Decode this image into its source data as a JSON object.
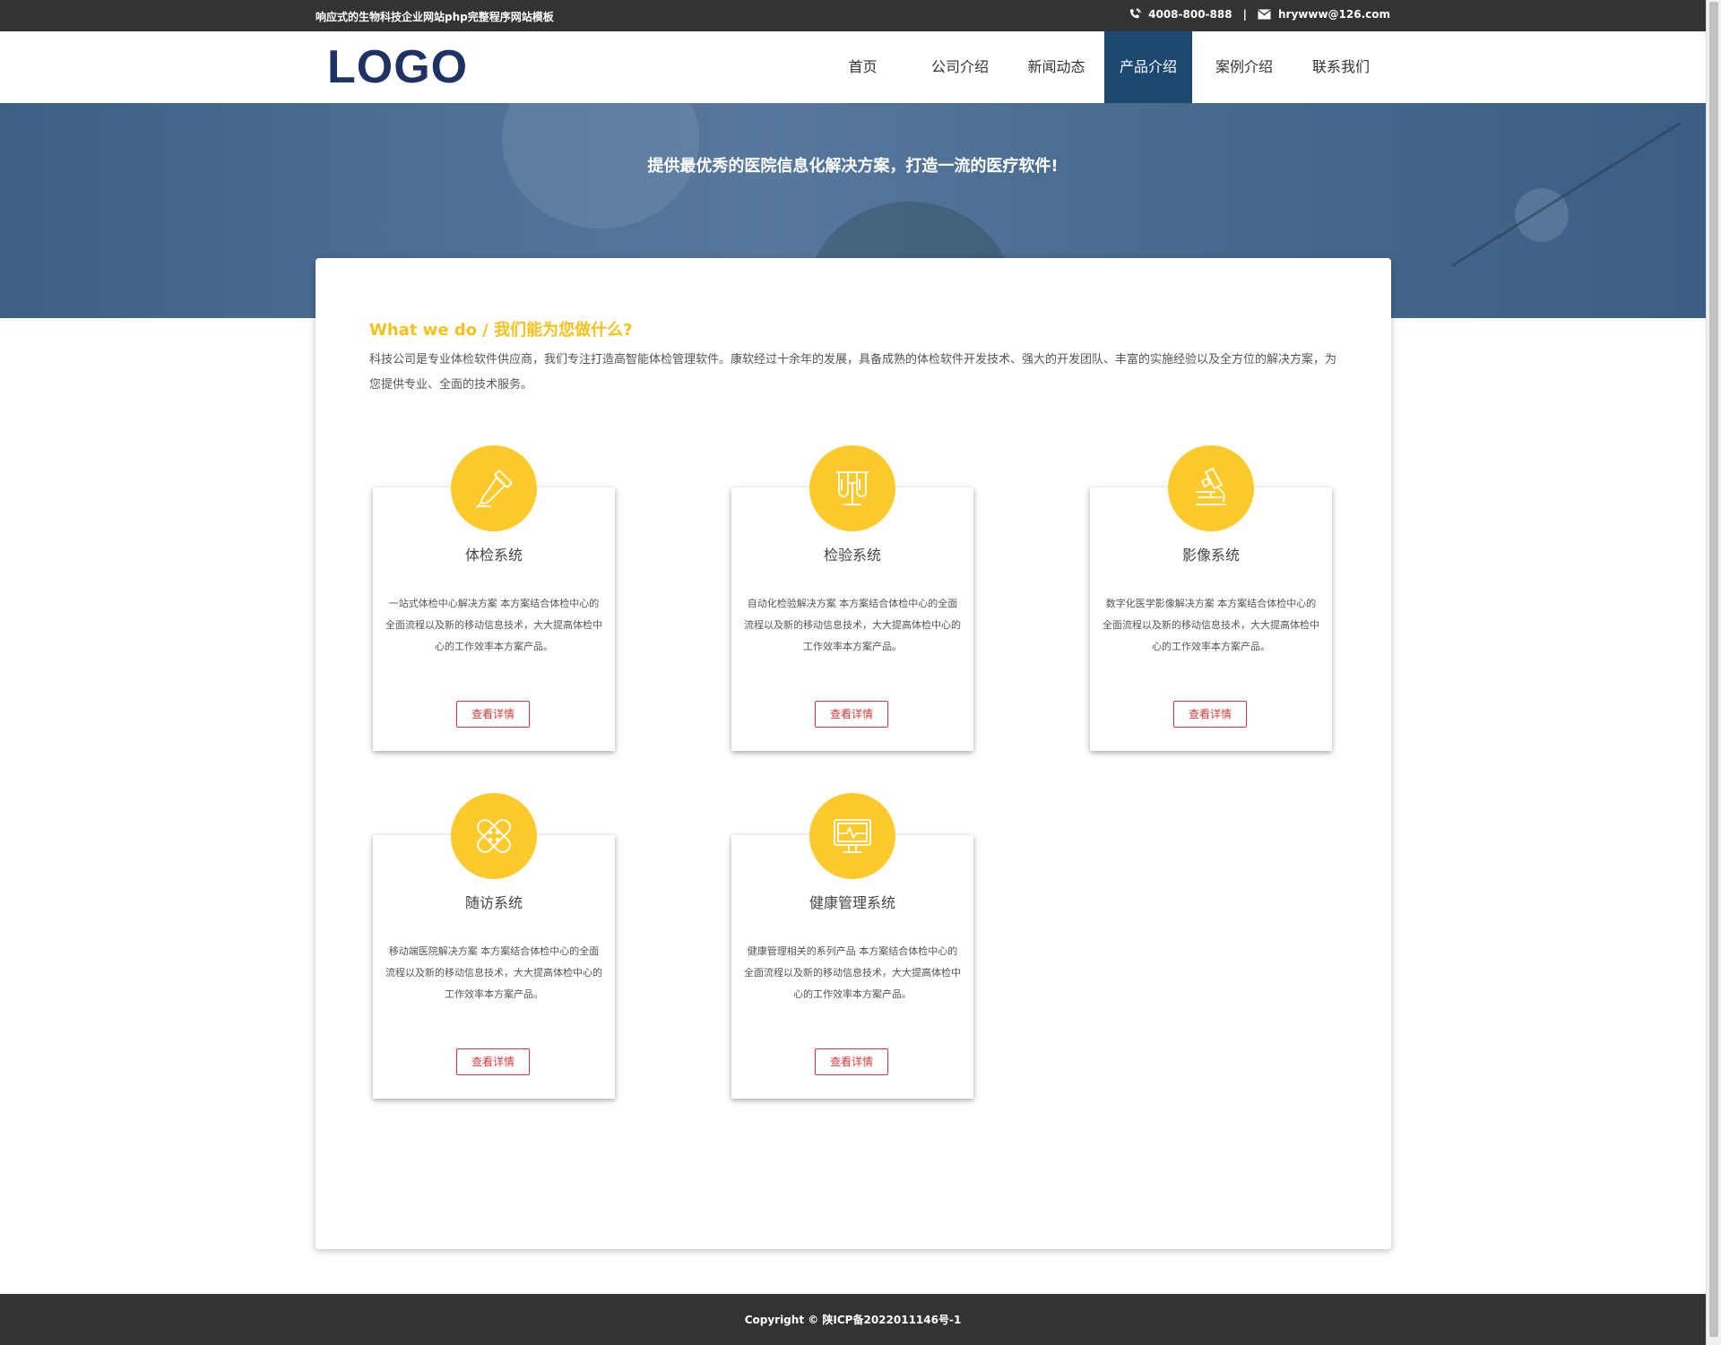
{
  "topbar": {
    "site_name": "响应式的生物科技企业网站php完整程序网站模板",
    "phone": "4008-800-888",
    "separator": "|",
    "email": "hrywww@126.com"
  },
  "header": {
    "logo": "LOGO",
    "nav": [
      {
        "label": "首页",
        "active": false
      },
      {
        "label": "公司介绍",
        "active": false
      },
      {
        "label": "新闻动态",
        "active": false
      },
      {
        "label": "产品介绍",
        "active": true
      },
      {
        "label": "案例介绍",
        "active": false
      },
      {
        "label": "联系我们",
        "active": false
      }
    ]
  },
  "banner": {
    "tagline": "提供最优秀的医院信息化解决方案，打造一流的医疗软件!"
  },
  "section": {
    "title": "What we do / 我们能为您做什么?",
    "intro": "科技公司是专业体检软件供应商，我们专注打造高智能体检管理软件。康软经过十余年的发展，具备成熟的体检软件开发技术、强大的开发团队、丰富的实施经验以及全方位的解决方案，为您提供专业、全面的技术服务。"
  },
  "products": [
    {
      "title": "体检系统",
      "icon": "dropper-icon",
      "desc": "一站式体检中心解决方案 本方案结合体检中心的全面流程以及新的移动信息技术，大大提高体检中心的工作效率本方案产品。",
      "button": "查看详情"
    },
    {
      "title": "检验系统",
      "icon": "test-tubes-icon",
      "desc": "自动化检验解决方案 本方案结合体检中心的全面流程以及新的移动信息技术，大大提高体检中心的工作效率本方案产品。",
      "button": "查看详情"
    },
    {
      "title": "影像系统",
      "icon": "microscope-icon",
      "desc": "数字化医学影像解决方案 本方案结合体检中心的全面流程以及新的移动信息技术，大大提高体检中心的工作效率本方案产品。",
      "button": "查看详情"
    },
    {
      "title": "随访系统",
      "icon": "bandage-icon",
      "desc": "移动端医院解决方案 本方案结合体检中心的全面流程以及新的移动信息技术，大大提高体检中心的工作效率本方案产品。",
      "button": "查看详情"
    },
    {
      "title": "健康管理系统",
      "icon": "monitor-icon",
      "desc": "健康管理相关的系列产品 本方案结合体检中心的全面流程以及新的移动信息技术，大大提高体检中心的工作效率本方案产品。",
      "button": "查看详情"
    }
  ],
  "footer": {
    "copyright": "Copyright © 陕ICP备2022011146号-1"
  },
  "colors": {
    "accent_yellow": "#fdc92c",
    "title_yellow": "#f4c11d",
    "nav_active": "#1c4871",
    "button_red": "#d9383a",
    "dark_bar": "#333333",
    "logo_blue": "#1e3264"
  }
}
